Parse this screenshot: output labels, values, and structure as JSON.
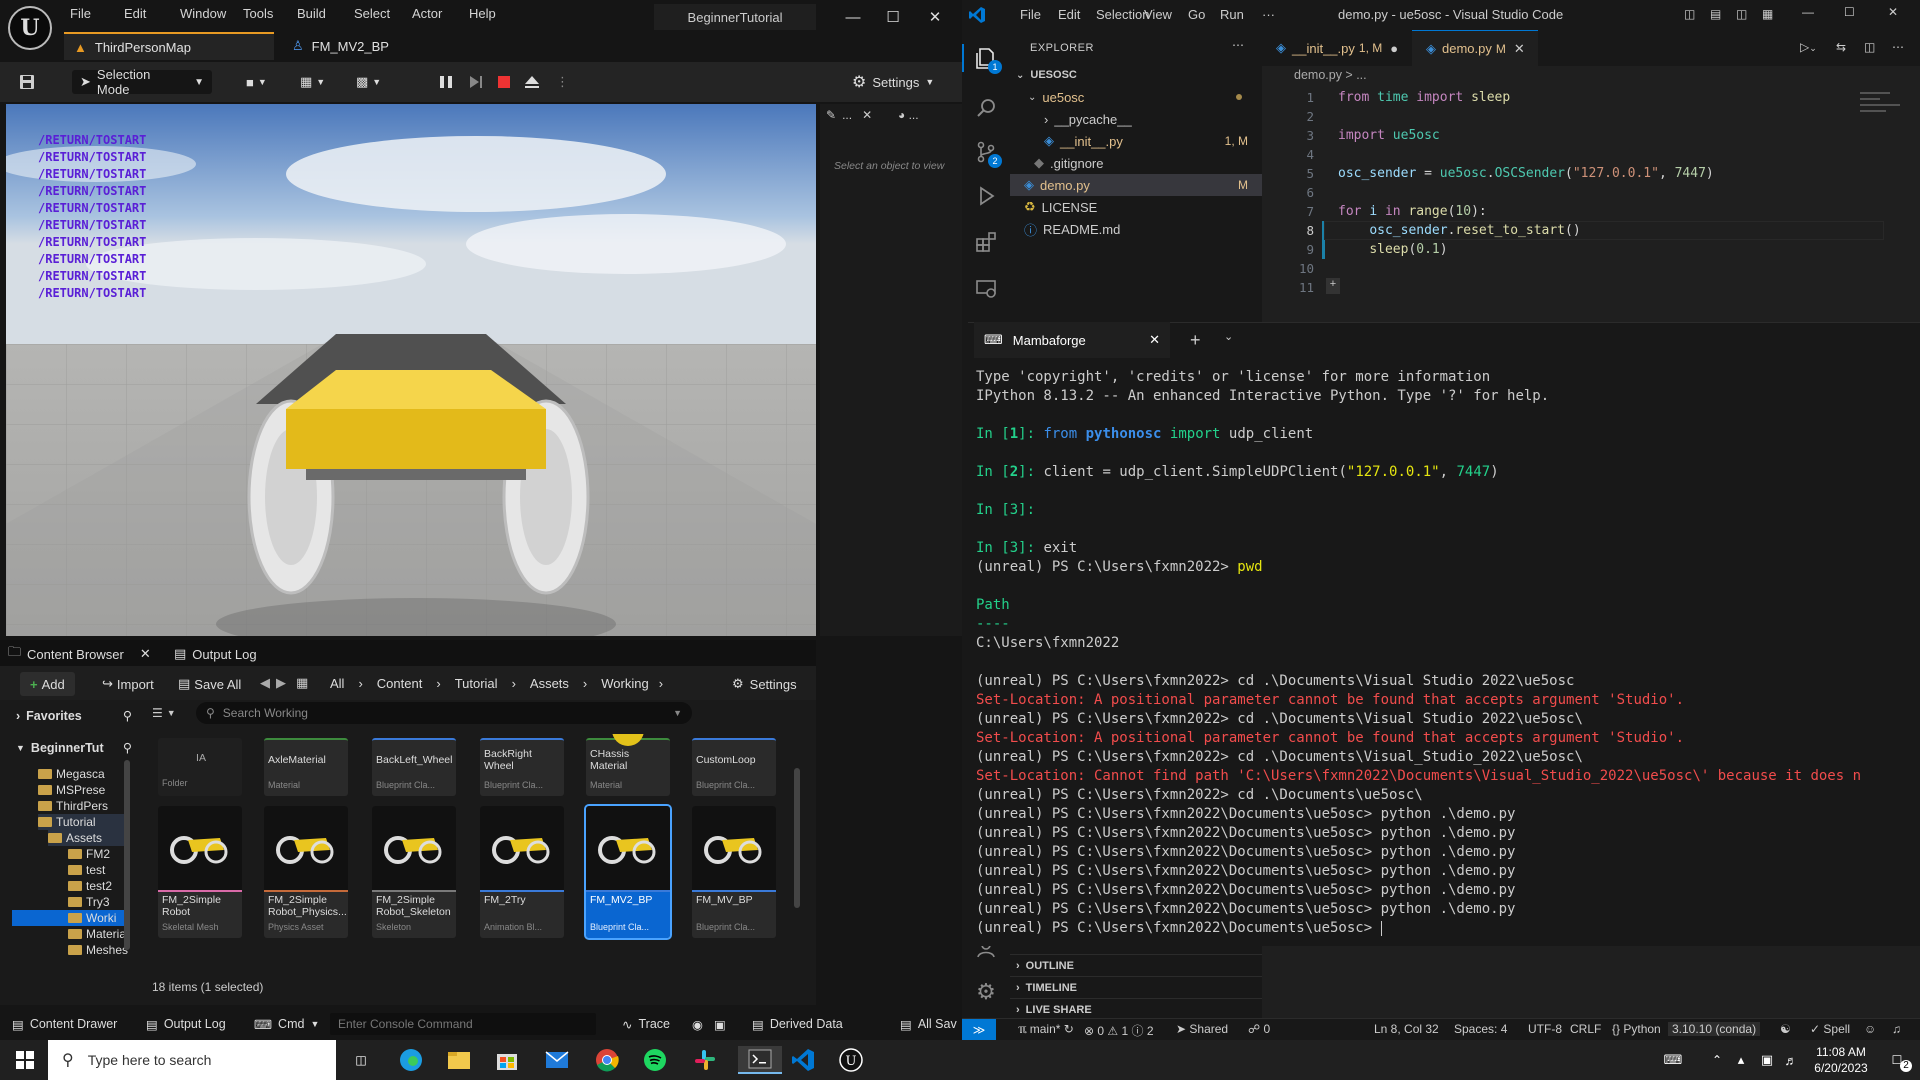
{
  "unreal": {
    "menu": [
      "File",
      "Edit",
      "Window",
      "Tools",
      "Build",
      "Select",
      "Actor",
      "Help"
    ],
    "project_name": "BeginnerTutorial",
    "tabs": [
      "ThirdPersonMap",
      "FM_MV2_BP"
    ],
    "toolbar": {
      "selection_mode": "Selection Mode",
      "settings": "Settings"
    },
    "viewport_log": [
      "/RETURN/TOSTART",
      "/RETURN/TOSTART",
      "/RETURN/TOSTART",
      "/RETURN/TOSTART",
      "/RETURN/TOSTART",
      "/RETURN/TOSTART",
      "/RETURN/TOSTART",
      "/RETURN/TOSTART",
      "/RETURN/TOSTART",
      "/RETURN/TOSTART"
    ],
    "details_hint": "Select an object to view",
    "content_browser": {
      "tabs": [
        "Content Browser",
        "Output Log"
      ],
      "add": "Add",
      "import": "Import",
      "save_all": "Save All",
      "settings": "Settings",
      "path": [
        "All",
        "Content",
        "Tutorial",
        "Assets",
        "Working"
      ],
      "favorites": "Favorites",
      "root": "BeginnerTut",
      "search_placeholder": "Search Working",
      "tree": [
        "Megasca",
        "MSPrese",
        "ThirdPers",
        "Tutorial",
        "Assets",
        "FM2",
        "test",
        "test2",
        "Try3",
        "Worki",
        "Materia",
        "Meshes"
      ],
      "top_row": [
        {
          "name": "IA",
          "type": "Folder"
        },
        {
          "name": "AxleMaterial",
          "type": "Material"
        },
        {
          "name": "BackLeft_Wheel",
          "type": "Blueprint Cla..."
        },
        {
          "name": "BackRight Wheel",
          "type": "Blueprint Cla..."
        },
        {
          "name": "CHassis Material",
          "type": "Material"
        },
        {
          "name": "CustomLoop",
          "type": "Blueprint Cla..."
        }
      ],
      "assets": [
        {
          "name": "FM_2Simple Robot",
          "type": "Skeletal Mesh"
        },
        {
          "name": "FM_2Simple Robot_Physics...",
          "type": "Physics Asset"
        },
        {
          "name": "FM_2Simple Robot_Skeleton",
          "type": "Skeleton"
        },
        {
          "name": "FM_2Try",
          "type": "Animation Bl..."
        },
        {
          "name": "FM_MV2_BP",
          "type": "Blueprint Cla..."
        },
        {
          "name": "FM_MV_BP",
          "type": "Blueprint Cla..."
        }
      ],
      "count": "18 items (1 selected)"
    },
    "status": {
      "content_drawer": "Content Drawer",
      "output_log": "Output Log",
      "cmd": "Cmd",
      "console_placeholder": "Enter Console Command",
      "trace": "Trace",
      "derived_data": "Derived Data",
      "all_saved": "All Sav"
    }
  },
  "vscode": {
    "menu": [
      "File",
      "Edit",
      "Selection",
      "View",
      "Go",
      "Run",
      "···"
    ],
    "title": "demo.py - ue5osc - Visual Studio Code",
    "explorer": {
      "header": "EXPLORER",
      "root": "UESOSC",
      "items": [
        {
          "label": "ue5osc",
          "badge": ""
        },
        {
          "label": "__pycache__",
          "badge": ""
        },
        {
          "label": "__init__.py",
          "badge": "1, M"
        },
        {
          "label": ".gitignore",
          "badge": ""
        },
        {
          "label": "demo.py",
          "badge": "M"
        },
        {
          "label": "LICENSE",
          "badge": ""
        },
        {
          "label": "README.md",
          "badge": ""
        }
      ],
      "outline": "OUTLINE",
      "timeline": "TIMELINE",
      "live_share": "LIVE SHARE"
    },
    "tabs": [
      {
        "label": "__init__.py",
        "status": "1, M"
      },
      {
        "label": "demo.py",
        "status": "M"
      }
    ],
    "breadcrumb": "demo.py > ...",
    "line_numbers": [
      "1",
      "2",
      "3",
      "4",
      "5",
      "6",
      "7",
      "8",
      "9",
      "10",
      "11"
    ],
    "code": [
      "from time import sleep",
      "",
      "import ue5osc",
      "",
      "osc_sender = ue5osc.OSCSender(\"127.0.0.1\", 7447)",
      "",
      "for i in range(10):",
      "    osc_sender.reset_to_start()",
      "    sleep(0.1)",
      "",
      ""
    ],
    "terminal": {
      "tab": "Mambaforge",
      "lines": [
        "Type 'copyright', 'credits' or 'license' for more information",
        "IPython 8.13.2 -- An enhanced Interactive Python. Type '?' for help.",
        "",
        "In [1]: from pythonosc import udp_client",
        "",
        "In [2]: client = udp_client.SimpleUDPClient(\"127.0.0.1\", 7447)",
        "",
        "In [3]: ",
        "",
        "In [3]: exit",
        "(unreal) PS C:\\Users\\fxmn2022> pwd",
        "",
        "Path",
        "----",
        "C:\\Users\\fxmn2022",
        "",
        "(unreal) PS C:\\Users\\fxmn2022> cd .\\Documents\\Visual Studio 2022\\ue5osc",
        "Set-Location: A positional parameter cannot be found that accepts argument 'Studio'.",
        "(unreal) PS C:\\Users\\fxmn2022> cd .\\Documents\\Visual Studio 2022\\ue5osc\\",
        "Set-Location: A positional parameter cannot be found that accepts argument 'Studio'.",
        "(unreal) PS C:\\Users\\fxmn2022> cd .\\Documents\\Visual_Studio_2022\\ue5osc\\",
        "Set-Location: Cannot find path 'C:\\Users\\fxmn2022\\Documents\\Visual_Studio_2022\\ue5osc\\' because it does n",
        "(unreal) PS C:\\Users\\fxmn2022> cd .\\Documents\\ue5osc\\",
        "(unreal) PS C:\\Users\\fxmn2022\\Documents\\ue5osc> python .\\demo.py",
        "(unreal) PS C:\\Users\\fxmn2022\\Documents\\ue5osc> python .\\demo.py",
        "(unreal) PS C:\\Users\\fxmn2022\\Documents\\ue5osc> python .\\demo.py",
        "(unreal) PS C:\\Users\\fxmn2022\\Documents\\ue5osc> python .\\demo.py",
        "(unreal) PS C:\\Users\\fxmn2022\\Documents\\ue5osc> python .\\demo.py",
        "(unreal) PS C:\\Users\\fxmn2022\\Documents\\ue5osc> python .\\demo.py",
        "(unreal) PS C:\\Users\\fxmn2022\\Documents\\ue5osc> "
      ]
    },
    "status": {
      "branch": "main*",
      "problems": "0",
      "warnings": "1",
      "infos": "2",
      "shared": "Shared",
      "ports": "0",
      "cursor": "Ln 8, Col 32",
      "spaces": "Spaces: 4",
      "encoding": "UTF-8",
      "eol": "CRLF",
      "language": "Python",
      "interpreter": "3.10.10 (conda)",
      "spell": "Spell"
    }
  },
  "taskbar": {
    "search_placeholder": "Type here to search",
    "time": "11:08 AM",
    "date": "6/20/2023",
    "notifications": "2"
  },
  "colors": {
    "vscode_accent": "#0078d4",
    "ue_select": "#0a66d1",
    "terminal_error": "#f14c4c",
    "terminal_ok": "#23d18b",
    "violet": "#5a1fd6"
  }
}
